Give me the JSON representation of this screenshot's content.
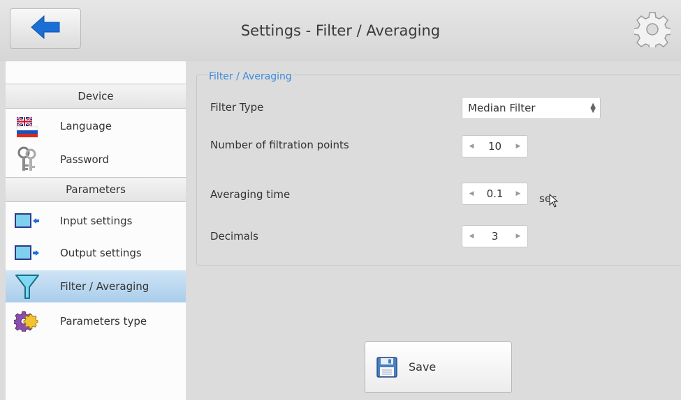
{
  "header": {
    "title": "Settings - Filter / Averaging",
    "back_icon": "arrow-left-icon",
    "settings_icon": "gear-icon"
  },
  "sidebar": {
    "sections": [
      {
        "label": "Device"
      },
      {
        "label": "Parameters"
      }
    ],
    "items": [
      {
        "label": "Language",
        "icon": "flags-icon"
      },
      {
        "label": "Password",
        "icon": "keys-icon"
      },
      {
        "label": "Input settings",
        "icon": "input-monitor-icon"
      },
      {
        "label": "Output settings",
        "icon": "output-monitor-icon"
      },
      {
        "label": "Filter / Averaging",
        "icon": "funnel-icon",
        "active": true
      },
      {
        "label": "Parameters type",
        "icon": "gears-icon"
      }
    ]
  },
  "main": {
    "group_title": "Filter / Averaging",
    "filter_type": {
      "label": "Filter Type",
      "value": "Median Filter"
    },
    "filtration_points": {
      "label": "Number of filtration points",
      "value": "10"
    },
    "averaging_time": {
      "label": "Averaging time",
      "value": "0.1",
      "unit": "sec"
    },
    "decimals": {
      "label": "Decimals",
      "value": "3"
    }
  },
  "save": {
    "label": "Save",
    "icon": "floppy-disk-icon"
  },
  "colors": {
    "accent": "#3b8ad9",
    "active_item": "#b7d6ef",
    "back_arrow": "#1a6fd6"
  }
}
